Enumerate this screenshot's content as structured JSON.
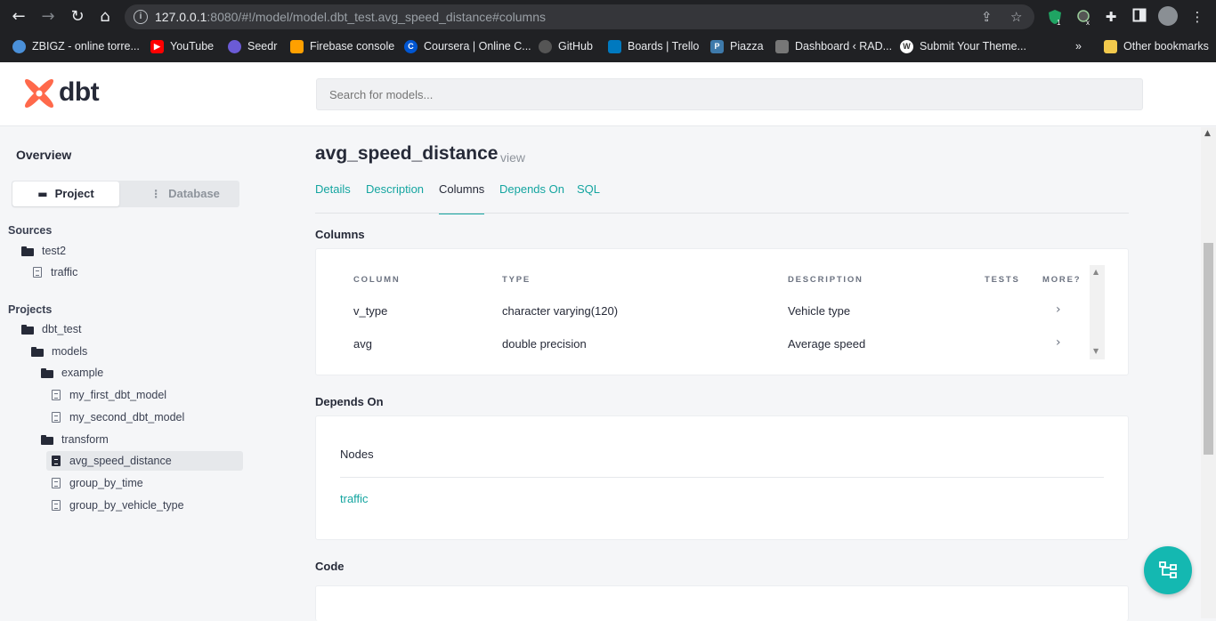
{
  "browser": {
    "url_host": "127.0.0.1",
    "url_rest": ":8080/#!/model/model.dbt_test.avg_speed_distance#columns",
    "extension_badge_1": "1",
    "extension_badge_2": "x",
    "bookmarks": [
      {
        "label": "ZBIGZ - online torre...",
        "icon": "cloud-icon",
        "color": "#4a90d9"
      },
      {
        "label": "YouTube",
        "icon": "youtube-icon",
        "color": "#ff0000"
      },
      {
        "label": "Seedr",
        "icon": "seedr-icon",
        "color": "#6b5bd6"
      },
      {
        "label": "Firebase console",
        "icon": "firebase-icon",
        "color": "#ffa000"
      },
      {
        "label": "Coursera | Online C...",
        "icon": "coursera-icon",
        "color": "#0056d2"
      },
      {
        "label": "GitHub",
        "icon": "github-icon",
        "color": "#333333"
      },
      {
        "label": "Boards | Trello",
        "icon": "trello-icon",
        "color": "#0079bf"
      },
      {
        "label": "Piazza",
        "icon": "piazza-icon",
        "color": "#3e7aab"
      },
      {
        "label": "Dashboard ‹ RAD...",
        "icon": "dashboard-icon",
        "color": "#777777"
      },
      {
        "label": "Submit Your Theme...",
        "icon": "wordpress-icon",
        "color": "#ffffff"
      }
    ],
    "overflow": "»",
    "other_bookmarks": "Other bookmarks"
  },
  "app": {
    "logo": "dbt",
    "search_placeholder": "Search for models..."
  },
  "sidebar": {
    "overview": "Overview",
    "toggle": {
      "project": "Project",
      "database": "Database"
    },
    "sources_label": "Sources",
    "sources": [
      {
        "label": "test2",
        "kind": "folder"
      },
      {
        "label": "traffic",
        "kind": "file"
      }
    ],
    "projects_label": "Projects",
    "projects": [
      {
        "label": "dbt_test",
        "kind": "folder"
      },
      {
        "label": "models",
        "kind": "folder"
      },
      {
        "label": "example",
        "kind": "folder"
      },
      {
        "label": "my_first_dbt_model",
        "kind": "file"
      },
      {
        "label": "my_second_dbt_model",
        "kind": "file"
      },
      {
        "label": "transform",
        "kind": "folder"
      },
      {
        "label": "avg_speed_distance",
        "kind": "file",
        "selected": true
      },
      {
        "label": "group_by_time",
        "kind": "file"
      },
      {
        "label": "group_by_vehicle_type",
        "kind": "file"
      }
    ]
  },
  "model": {
    "name": "avg_speed_distance",
    "kind": "view",
    "tabs": [
      "Details",
      "Description",
      "Columns",
      "Depends On",
      "SQL"
    ],
    "active_tab": "Columns"
  },
  "columns_section": {
    "title": "Columns",
    "headers": [
      "COLUMN",
      "TYPE",
      "DESCRIPTION",
      "TESTS",
      "MORE?"
    ],
    "rows": [
      {
        "column": "v_type",
        "type": "character varying(120)",
        "description": "Vehicle type",
        "tests": "",
        "more": "›"
      },
      {
        "column": "avg",
        "type": "double precision",
        "description": "Average speed",
        "tests": "",
        "more": "›"
      }
    ]
  },
  "depends_section": {
    "title": "Depends On",
    "tab": "Nodes",
    "nodes": [
      "traffic"
    ]
  },
  "code_section": {
    "title": "Code"
  },
  "colors": {
    "accent": "#14a5a0",
    "fab": "#14b8b1",
    "logo": "#ff694b",
    "text": "#262a38"
  }
}
